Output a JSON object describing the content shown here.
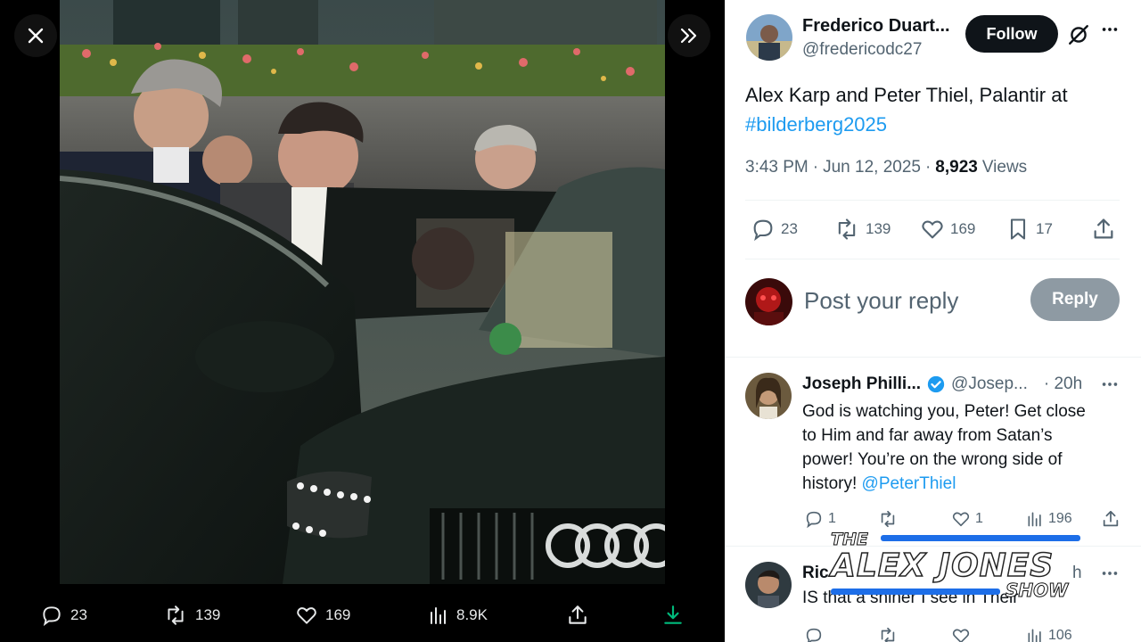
{
  "media": {
    "actions": {
      "replies": "23",
      "reposts": "139",
      "likes": "169",
      "views": "8.9K"
    }
  },
  "tweet": {
    "author_name": "Frederico Duart...",
    "author_handle": "@fredericodc27",
    "follow_label": "Follow",
    "text_line1": "Alex Karp and Peter Thiel, Palantir at",
    "hashtag": "#bilderberg2025",
    "time": "3:43 PM",
    "date": "Jun 12, 2025",
    "views_count": "8,923",
    "views_label": "Views",
    "stats": {
      "replies": "23",
      "reposts": "139",
      "likes": "169",
      "bookmarks": "17"
    }
  },
  "composer": {
    "placeholder": "Post your reply",
    "reply_label": "Reply"
  },
  "replies": [
    {
      "name": "Joseph Philli...",
      "handle": "@Josep...",
      "age": "· 20h",
      "text_line1": "God is watching you, Peter! Get close",
      "text_line2": "to Him and far away from Satan’s",
      "text_line3": "power! You’re on the wrong side of",
      "text_line4_prefix": "history!",
      "mention": "@PeterThiel",
      "stats": {
        "replies": "1",
        "likes": "1",
        "views": "196"
      }
    },
    {
      "name": "Ric",
      "age": "h",
      "text_line1": "IS that a shiner I see in Their",
      "stats": {
        "views": "106"
      }
    }
  ],
  "watermark": {
    "line1": "THE",
    "line2": "ALEX JONES",
    "line3": "SHOW"
  },
  "colors": {
    "accent": "#1d9bf0",
    "text": "#0f1419",
    "muted": "#536471",
    "reply_button": "#8e9aa3",
    "download": "#00ba7c"
  }
}
